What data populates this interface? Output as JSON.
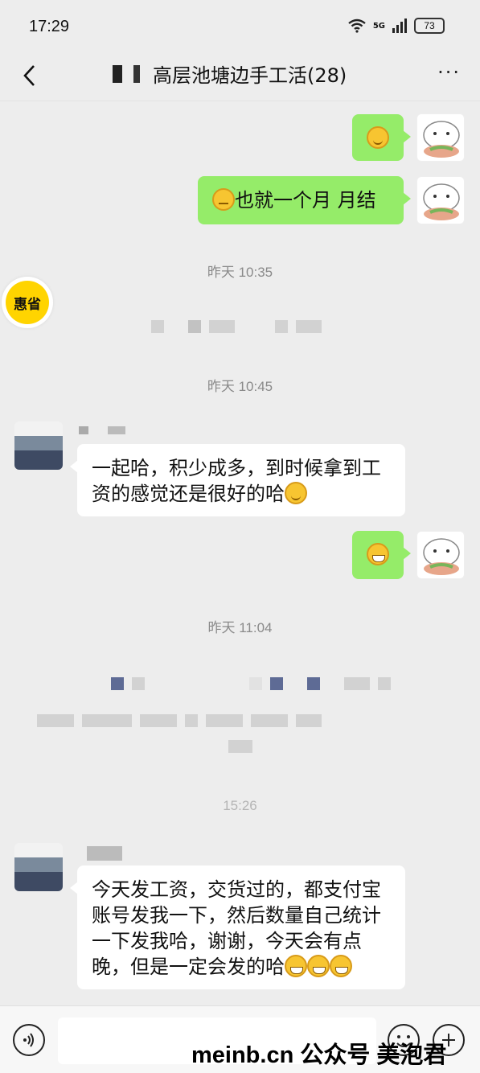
{
  "status_bar": {
    "time": "17:29",
    "network": "5G",
    "battery": "73"
  },
  "header": {
    "title": "高层池塘边手工活(28)",
    "more": "···"
  },
  "messages": {
    "m1": {
      "side": "right",
      "kind": "emoji",
      "emoji": "thinking-emoji"
    },
    "m2": {
      "side": "right",
      "text": "也就一个月 月结"
    },
    "ts1": "昨天 10:35",
    "ts2": "昨天 10:45",
    "m3": {
      "side": "left",
      "text": "一起哈，积少成多，到时候拿到工资的感觉还是很好的哈"
    },
    "m4": {
      "side": "right",
      "kind": "emoji",
      "emoji": "grin-emoji"
    },
    "ts3": "昨天 11:04",
    "ts4": "15:26",
    "m5": {
      "side": "left",
      "text": "今天发工资，交货过的，都支付宝账号发我一下，然后数量自己统计一下发我哈，谢谢，今天会有点晚，但是一定会发的哈"
    }
  },
  "overlay": {
    "huidi_logo": "惠省"
  },
  "watermark": "meinb.cn  公众号 美泡君",
  "colors": {
    "background": "#ededed",
    "bubble_green": "#95ec69",
    "bubble_white": "#ffffff",
    "logo_yellow": "#ffd400"
  }
}
